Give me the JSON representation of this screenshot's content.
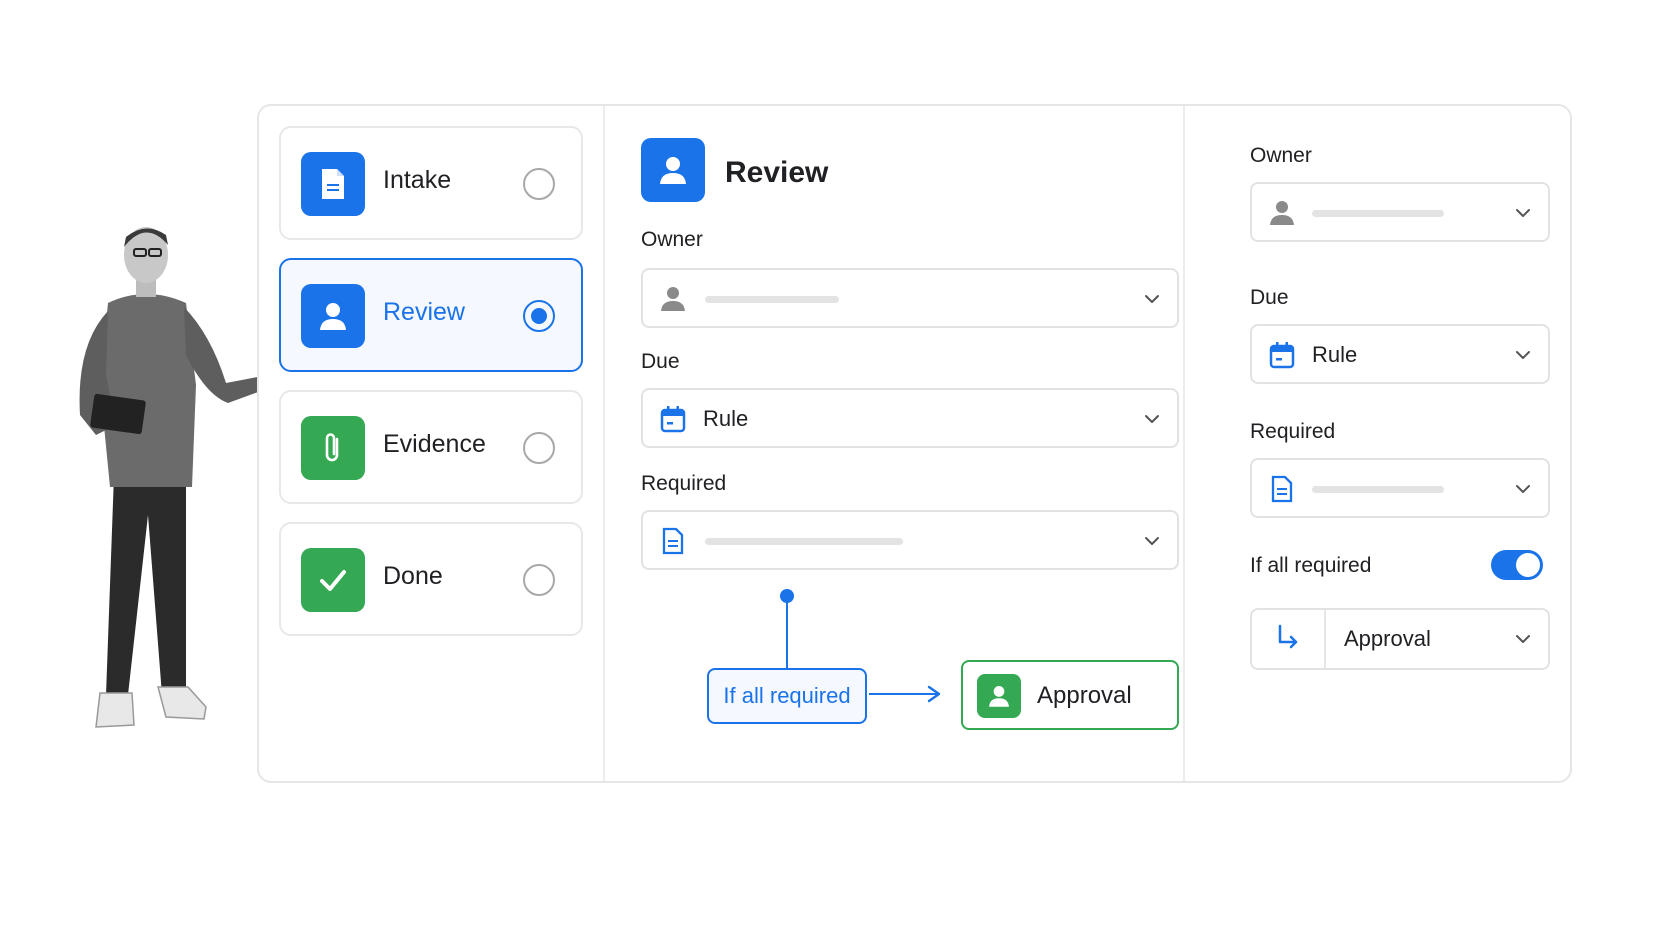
{
  "steps": [
    {
      "label": "Intake",
      "icon": "document-icon",
      "color": "#1a73e8",
      "selected": false
    },
    {
      "label": "Review",
      "icon": "person-icon",
      "color": "#1a73e8",
      "selected": true
    },
    {
      "label": "Evidence",
      "icon": "paperclip-icon",
      "color": "#34a853",
      "selected": false
    },
    {
      "label": "Done",
      "icon": "checkmark-icon",
      "color": "#34a853",
      "selected": false
    }
  ],
  "detail": {
    "title": "Review",
    "owner_label": "Owner",
    "due_label": "Due",
    "due_value": "Rule",
    "required_label": "Required",
    "condition_label": "If all required",
    "target_label": "Approval"
  },
  "sidebar": {
    "owner_label": "Owner",
    "due_label": "Due",
    "due_value": "Rule",
    "required_label": "Required",
    "toggle_label": "If all required",
    "toggle_on": true,
    "route_value": "Approval"
  },
  "colors": {
    "accent": "#1a73e8",
    "success": "#34a853",
    "border": "#e6e6e6"
  }
}
